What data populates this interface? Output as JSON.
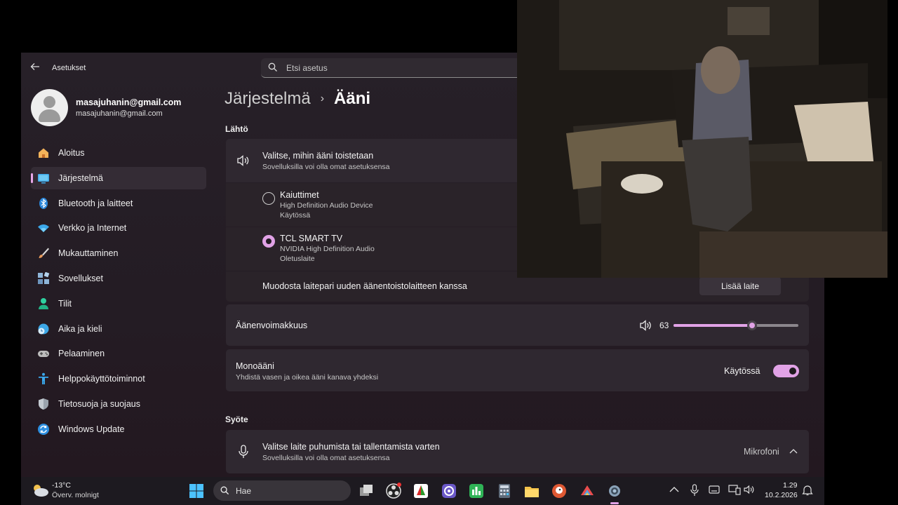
{
  "window": {
    "app_title": "Asetukset",
    "search_placeholder": "Etsi asetus"
  },
  "profile": {
    "name": "masajuhanin@gmail.com",
    "email": "masajuhanin@gmail.com"
  },
  "nav": [
    {
      "label": "Aloitus",
      "icon": "home-icon",
      "active": false
    },
    {
      "label": "Järjestelmä",
      "icon": "system-icon",
      "active": true
    },
    {
      "label": "Bluetooth ja laitteet",
      "icon": "bluetooth-icon",
      "active": false
    },
    {
      "label": "Verkko ja Internet",
      "icon": "wifi-icon",
      "active": false
    },
    {
      "label": "Mukauttaminen",
      "icon": "brush-icon",
      "active": false
    },
    {
      "label": "Sovellukset",
      "icon": "apps-icon",
      "active": false
    },
    {
      "label": "Tilit",
      "icon": "account-icon",
      "active": false
    },
    {
      "label": "Aika ja kieli",
      "icon": "clock-globe-icon",
      "active": false
    },
    {
      "label": "Pelaaminen",
      "icon": "gamepad-icon",
      "active": false
    },
    {
      "label": "Helppokäyttötoiminnot",
      "icon": "accessibility-icon",
      "active": false
    },
    {
      "label": "Tietosuoja ja suojaus",
      "icon": "shield-icon",
      "active": false
    },
    {
      "label": "Windows Update",
      "icon": "update-icon",
      "active": false
    }
  ],
  "breadcrumb": {
    "parent": "Järjestelmä",
    "separator": "›",
    "current": "Ääni"
  },
  "output": {
    "heading": "Lähtö",
    "choose_title": "Valitse, mihin ääni toistetaan",
    "choose_sub": "Sovelluksilla voi olla omat asetuksensa",
    "devices": [
      {
        "name": "Kaiuttimet",
        "driver": "High Definition Audio Device",
        "status": "Käytössä",
        "selected": false
      },
      {
        "name": "TCL SMART TV",
        "driver": "NVIDIA High Definition Audio",
        "status": "Oletuslaite",
        "selected": true
      }
    ],
    "pair_label": "Muodosta laitepari uuden äänentoistolaitteen kanssa",
    "pair_button": "Lisää laite"
  },
  "volume": {
    "label": "Äänenvoimakkuus",
    "value": "63",
    "level": 0.63
  },
  "mono": {
    "title": "Monoääni",
    "subtitle": "Yhdistä vasen ja oikea ääni kanava yhdeksi",
    "state_label": "Käytössä",
    "on": true
  },
  "input": {
    "heading": "Syöte",
    "choose_title": "Valitse laite puhumista tai tallentamista varten",
    "choose_sub": "Sovelluksilla voi olla omat asetuksensa",
    "device": "Mikrofoni"
  },
  "taskbar": {
    "weather_temp": "-13°C",
    "weather_desc": "Överv. molnigt",
    "search_label": "Hae",
    "time": "1.29",
    "date": "10.2.2026"
  },
  "colors": {
    "accent": "#e1a2e6",
    "window_bg": "#261e26",
    "card_bg": "#2f2830"
  }
}
